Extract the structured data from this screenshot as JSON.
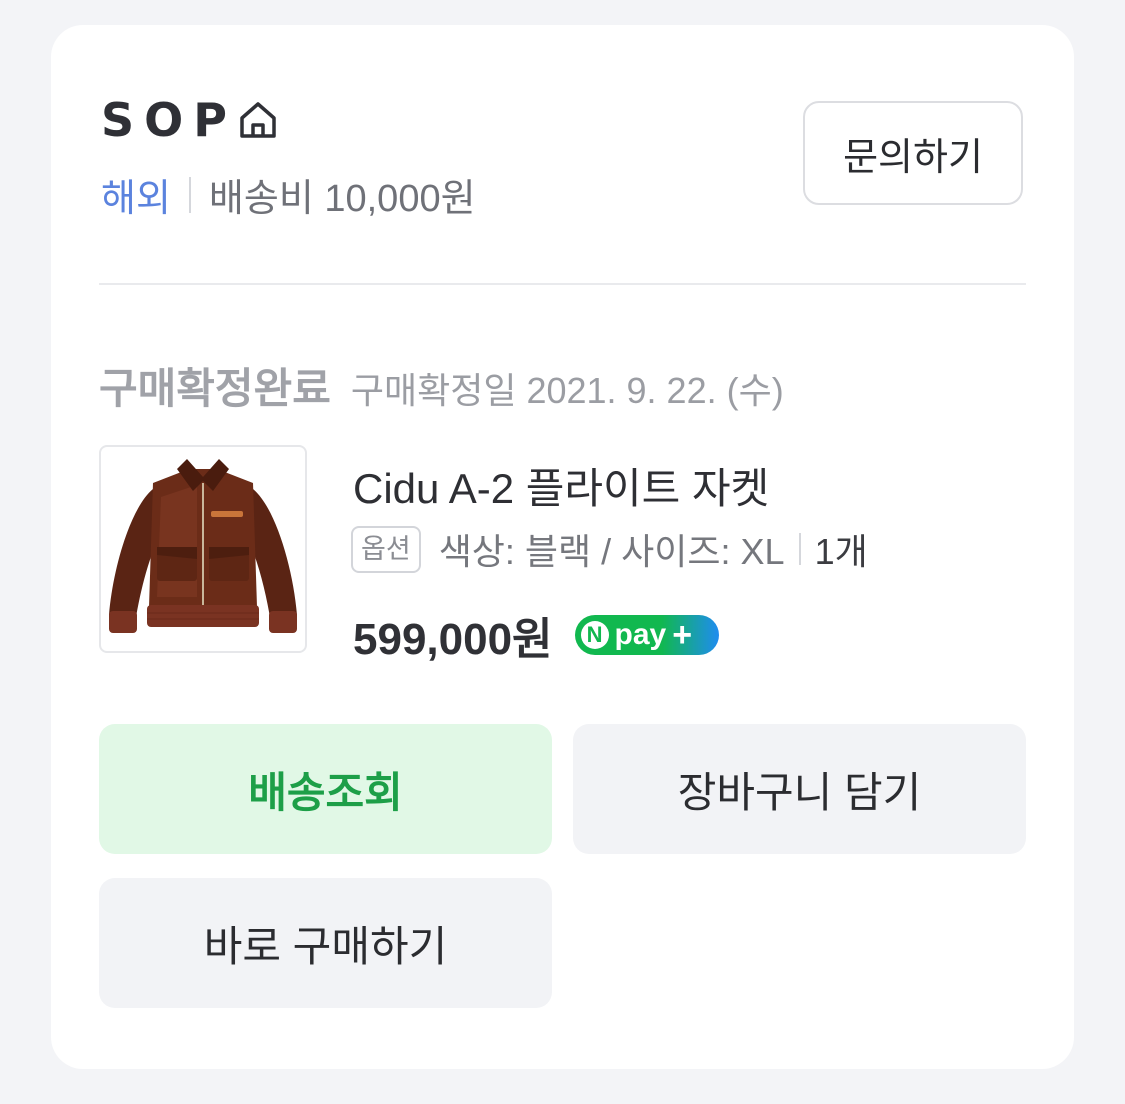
{
  "store": {
    "name": "SOP",
    "icon": "home-icon",
    "region": "해외",
    "shipping_fee": "배송비 10,000원",
    "inquiry_button": "문의하기"
  },
  "order": {
    "status": "구매확정완료",
    "confirm_date": "구매확정일 2021. 9. 22. (수)"
  },
  "product": {
    "name": "Cidu A-2 플라이트 자켓",
    "option_badge": "옵션",
    "option_text": "색상: 블랙 / 사이즈: XL",
    "quantity": "1개",
    "price": "599,000원",
    "npay": {
      "n": "N",
      "text": "pay",
      "plus": "+",
      "colors": {
        "green": "#11b84f",
        "blue": "#1f8cf0"
      }
    }
  },
  "actions": {
    "track_label": "배송조회",
    "cart_label": "장바구니 담기",
    "buy_label": "바로 구매하기"
  },
  "colors": {
    "accent_green": "#1d9f48",
    "accent_green_bg": "#e1f8e6",
    "overseas_blue": "#5b83de"
  }
}
